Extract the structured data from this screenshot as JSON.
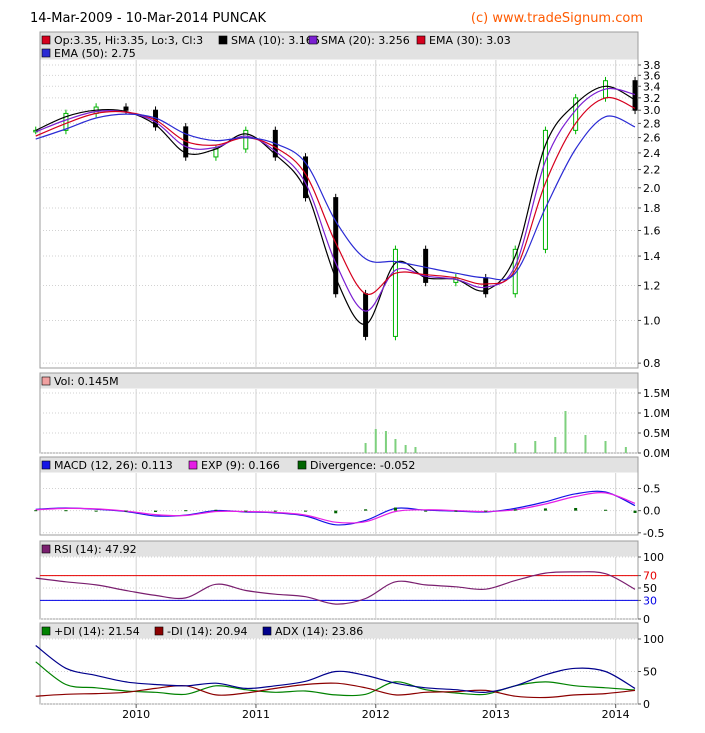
{
  "header": {
    "title": "14-Mar-2009 - 10-Mar-2014 PUNCAK",
    "credit": "(c) www.tradeSignum.com"
  },
  "colors": {
    "background": "#ffffff",
    "frame": "#9c9c9c",
    "grid": "#d2d2d2",
    "legend_bg": "#e2e2e2",
    "up_candle": "#00b400",
    "down_candle": "#000000",
    "sma10": "#000000",
    "sma20": "#7b1fd2",
    "ema30": "#d6001e",
    "ema50": "#2b2bd4",
    "volume": "#7ed07e",
    "macd": "#1414e6",
    "exp": "#e61ee6",
    "divergence": "#006400",
    "rsi": "#7a1f6f",
    "rsi_over": "#e60000",
    "rsi_under": "#0000e6",
    "plus_di": "#008200",
    "minus_di": "#8c0000",
    "adx": "#00008c"
  },
  "x_axis": {
    "labels": [
      "2010",
      "2011",
      "2012",
      "2013",
      "2014"
    ]
  },
  "chart_data": [
    {
      "type": "line",
      "panel": "price",
      "legend": [
        "Op:3.35, Hi:3.35, Lo:3, Cl:3",
        "SMA (10): 3.166",
        "SMA (20): 3.256",
        "EMA (30): 3.03",
        "EMA (50): 2.75"
      ],
      "ylim": [
        0.78,
        3.9
      ],
      "yscale": "log",
      "yticks": [
        "3.8",
        "3.6",
        "3.4",
        "3.2",
        "3.0",
        "2.8",
        "2.6",
        "2.4",
        "2.2",
        "2.0",
        "1.8",
        "1.6",
        "1.4",
        "1.2",
        "1.0",
        "0.8"
      ],
      "ytick_values": [
        3.8,
        3.6,
        3.4,
        3.2,
        3.0,
        2.8,
        2.6,
        2.4,
        2.2,
        2.0,
        1.8,
        1.6,
        1.4,
        1.2,
        1.0,
        0.8
      ],
      "x": [
        "2009-03",
        "2009-06",
        "2009-09",
        "2009-12",
        "2010-03",
        "2010-06",
        "2010-09",
        "2010-12",
        "2011-03",
        "2011-06",
        "2011-09",
        "2011-12",
        "2012-03",
        "2012-06",
        "2012-09",
        "2012-12",
        "2013-03",
        "2013-06",
        "2013-09",
        "2013-12",
        "2014-03"
      ],
      "series": [
        {
          "name": "Price",
          "values": [
            2.7,
            2.95,
            3.05,
            3.0,
            2.75,
            2.35,
            2.45,
            2.7,
            2.35,
            1.9,
            1.15,
            0.92,
            1.45,
            1.22,
            1.25,
            1.15,
            1.45,
            2.7,
            3.2,
            3.5,
            3.0
          ]
        },
        {
          "name": "SMA (10)",
          "values": [
            2.7,
            2.9,
            3.0,
            2.98,
            2.78,
            2.4,
            2.45,
            2.65,
            2.38,
            1.98,
            1.25,
            0.98,
            1.35,
            1.25,
            1.24,
            1.17,
            1.4,
            2.5,
            3.1,
            3.4,
            3.166
          ]
        },
        {
          "name": "SMA (20)",
          "values": [
            2.68,
            2.85,
            2.98,
            2.97,
            2.82,
            2.48,
            2.47,
            2.62,
            2.42,
            2.05,
            1.35,
            1.05,
            1.3,
            1.26,
            1.24,
            1.19,
            1.33,
            2.3,
            3.0,
            3.35,
            3.256
          ]
        },
        {
          "name": "EMA (30)",
          "values": [
            2.62,
            2.8,
            2.95,
            2.97,
            2.85,
            2.55,
            2.5,
            2.6,
            2.47,
            2.15,
            1.5,
            1.15,
            1.28,
            1.27,
            1.25,
            1.21,
            1.3,
            2.05,
            2.8,
            3.2,
            3.03
          ]
        },
        {
          "name": "EMA (50)",
          "values": [
            2.58,
            2.72,
            2.88,
            2.94,
            2.88,
            2.65,
            2.56,
            2.6,
            2.52,
            2.28,
            1.68,
            1.38,
            1.36,
            1.32,
            1.28,
            1.25,
            1.28,
            1.8,
            2.45,
            2.9,
            2.75
          ]
        }
      ]
    },
    {
      "type": "bar",
      "panel": "volume",
      "legend": [
        "Vol: 0.145M"
      ],
      "ylim": [
        0,
        1.6
      ],
      "yticks": [
        "1.5M",
        "1.0M",
        "0.5M",
        "0.0M"
      ],
      "ytick_values": [
        1.5,
        1.0,
        0.5,
        0.0
      ],
      "x": [
        "2011-12",
        "2012-01",
        "2012-02",
        "2012-03",
        "2012-04",
        "2012-05",
        "2013-03",
        "2013-05",
        "2013-07",
        "2013-08",
        "2013-10",
        "2013-12",
        "2014-02"
      ],
      "values": [
        0.25,
        0.6,
        0.55,
        0.35,
        0.2,
        0.15,
        0.25,
        0.3,
        0.4,
        1.05,
        0.45,
        0.3,
        0.15
      ]
    },
    {
      "type": "line",
      "panel": "macd",
      "legend": [
        "MACD (12, 26): 0.113",
        "EXP (9): 0.166",
        "Divergence: -0.052"
      ],
      "ylim": [
        -0.55,
        0.85
      ],
      "yticks": [
        "0.5",
        "0.0",
        "-0.5"
      ],
      "ytick_values": [
        0.5,
        0.0,
        -0.5
      ],
      "x": [
        "2009-03",
        "2009-06",
        "2009-09",
        "2009-12",
        "2010-03",
        "2010-06",
        "2010-09",
        "2010-12",
        "2011-03",
        "2011-06",
        "2011-09",
        "2011-12",
        "2012-03",
        "2012-06",
        "2012-09",
        "2012-12",
        "2013-03",
        "2013-06",
        "2013-09",
        "2013-12",
        "2014-03"
      ],
      "series": [
        {
          "name": "MACD (12, 26)",
          "values": [
            0.03,
            0.06,
            0.03,
            -0.02,
            -0.12,
            -0.1,
            0.0,
            -0.03,
            -0.05,
            -0.12,
            -0.32,
            -0.22,
            0.05,
            0.01,
            -0.01,
            -0.03,
            0.05,
            0.2,
            0.38,
            0.42,
            0.113
          ]
        },
        {
          "name": "EXP (9)",
          "values": [
            0.02,
            0.05,
            0.04,
            -0.01,
            -0.09,
            -0.11,
            -0.02,
            -0.02,
            -0.04,
            -0.1,
            -0.26,
            -0.25,
            -0.02,
            0.02,
            0.0,
            -0.02,
            0.02,
            0.15,
            0.32,
            0.4,
            0.166
          ]
        },
        {
          "name": "Divergence",
          "values": [
            0.01,
            0.01,
            -0.01,
            -0.01,
            -0.03,
            0.01,
            0.02,
            -0.01,
            -0.01,
            -0.02,
            -0.06,
            0.03,
            0.07,
            -0.01,
            -0.01,
            -0.01,
            0.03,
            0.05,
            0.06,
            0.02,
            -0.052
          ]
        }
      ]
    },
    {
      "type": "line",
      "panel": "rsi",
      "legend": [
        "RSI (14): 47.92"
      ],
      "ylim": [
        0,
        100
      ],
      "yticks": [
        "100",
        "70",
        "50",
        "30",
        "0"
      ],
      "ytick_values": [
        100,
        70,
        50,
        30,
        0
      ],
      "x": [
        "2009-03",
        "2009-06",
        "2009-09",
        "2009-12",
        "2010-03",
        "2010-06",
        "2010-09",
        "2010-12",
        "2011-03",
        "2011-06",
        "2011-09",
        "2011-12",
        "2012-03",
        "2012-06",
        "2012-09",
        "2012-12",
        "2013-03",
        "2013-06",
        "2013-09",
        "2013-12",
        "2014-03"
      ],
      "series": [
        {
          "name": "RSI (14)",
          "values": [
            66,
            60,
            55,
            46,
            38,
            34,
            56,
            46,
            40,
            36,
            24,
            33,
            60,
            55,
            52,
            48,
            62,
            74,
            76,
            73,
            47.92
          ]
        }
      ]
    },
    {
      "type": "line",
      "panel": "dmi",
      "legend": [
        "+DI (14): 21.54",
        "-DI (14): 20.94",
        "ADX (14): 23.86"
      ],
      "ylim": [
        0,
        100
      ],
      "yticks": [
        "100",
        "50",
        "0"
      ],
      "ytick_values": [
        100,
        50,
        0
      ],
      "x": [
        "2009-03",
        "2009-06",
        "2009-09",
        "2009-12",
        "2010-03",
        "2010-06",
        "2010-09",
        "2010-12",
        "2011-03",
        "2011-06",
        "2011-09",
        "2011-12",
        "2012-03",
        "2012-06",
        "2012-09",
        "2012-12",
        "2013-03",
        "2013-06",
        "2013-09",
        "2013-12",
        "2014-03"
      ],
      "series": [
        {
          "name": "+DI (14)",
          "values": [
            65,
            30,
            25,
            20,
            18,
            15,
            28,
            22,
            18,
            20,
            14,
            15,
            34,
            22,
            17,
            15,
            28,
            34,
            28,
            25,
            21.54
          ]
        },
        {
          "name": "-DI (14)",
          "values": [
            12,
            15,
            16,
            18,
            24,
            28,
            14,
            17,
            24,
            30,
            32,
            25,
            14,
            18,
            19,
            21,
            12,
            10,
            14,
            16,
            20.94
          ]
        },
        {
          "name": "ADX (14)",
          "values": [
            90,
            55,
            44,
            34,
            30,
            28,
            32,
            24,
            28,
            35,
            50,
            44,
            32,
            25,
            22,
            18,
            28,
            45,
            55,
            50,
            23.86
          ]
        }
      ]
    }
  ]
}
